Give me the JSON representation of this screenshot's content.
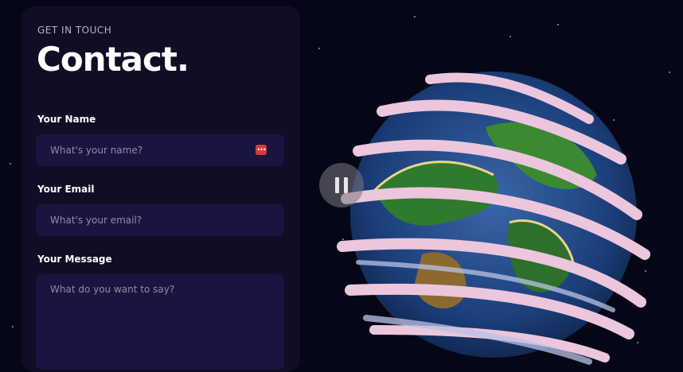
{
  "contact": {
    "eyebrow": "GET IN TOUCH",
    "title": "Contact.",
    "name_label": "Your Name",
    "name_placeholder": "What's your name?",
    "email_label": "Your Email",
    "email_placeholder": "What's your email?",
    "message_label": "Your Message",
    "message_placeholder": "What do you want to say?"
  },
  "media": {
    "pause_icon": "pause-icon",
    "password_manager_icon": "password-manager-icon"
  },
  "colors": {
    "background": "#050716",
    "panel": "#100d25",
    "field": "#1a1540",
    "badge": "#d63b3b"
  }
}
